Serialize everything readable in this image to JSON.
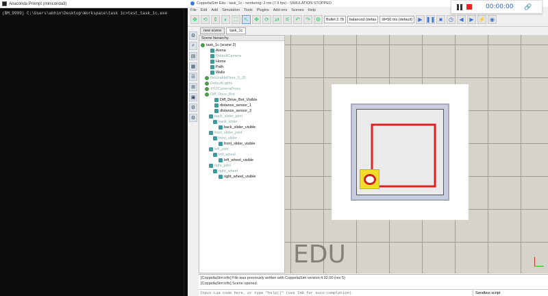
{
  "cmd": {
    "title": "Anaconda Prompt (miniconda3)",
    "line": "(BM_9999) C:\\Users\\abhin\\Desktop\\Workspace\\task 1c>test_task_1c.exe"
  },
  "coppelia": {
    "title": "CoppeliaSim Edu - task_1c - rendering: 2 ms (7.9 fps) - SIMULATION STOPPED",
    "menu": [
      "File",
      "Edit",
      "Add",
      "Simulation",
      "Tools",
      "Plugins",
      "Add-ons",
      "Scenes",
      "Help"
    ],
    "engine": "Bullet 2.78",
    "mode": "balanced (defau",
    "dt": "dt=50 ms (default)",
    "tabs": [
      "new scene",
      "task_1c"
    ],
    "hierarchy_title": "Scene hierarchy",
    "tree": [
      {
        "label": "task_1c (scene 2)",
        "x": 2,
        "dim": false,
        "icon": "globe"
      },
      {
        "label": "Arena",
        "x": 16,
        "dim": false,
        "icon": "shape"
      },
      {
        "label": "DefaultCamera",
        "x": 16,
        "dim": true,
        "icon": "shape"
      },
      {
        "label": "Home",
        "x": 16,
        "dim": false,
        "icon": "shape"
      },
      {
        "label": "Path",
        "x": 16,
        "dim": false,
        "icon": "shape"
      },
      {
        "label": "Walls",
        "x": 16,
        "dim": false,
        "icon": "shape"
      },
      {
        "label": "ResizableFloor_5_25",
        "x": 8,
        "dim": true,
        "icon": "globe"
      },
      {
        "label": "DefaultLights",
        "x": 8,
        "dim": true,
        "icon": "globe"
      },
      {
        "label": "XYZCameraProxy",
        "x": 8,
        "dim": true,
        "icon": "globe"
      },
      {
        "label": "Diff_Drive_Bot",
        "x": 8,
        "dim": true,
        "icon": "globe"
      },
      {
        "label": "Diff_Drive_Bot_Visible",
        "x": 22,
        "dim": false,
        "icon": "shape"
      },
      {
        "label": "distance_sensor_1",
        "x": 22,
        "dim": false,
        "icon": "shape"
      },
      {
        "label": "distance_sensor_2",
        "x": 22,
        "dim": false,
        "icon": "shape"
      },
      {
        "label": "back_slider_joint",
        "x": 14,
        "dim": true,
        "icon": "shape"
      },
      {
        "label": "back_slider",
        "x": 20,
        "dim": true,
        "icon": "shape"
      },
      {
        "label": "back_slider_visible",
        "x": 28,
        "dim": false,
        "icon": "shape"
      },
      {
        "label": "front_slider_joint",
        "x": 14,
        "dim": true,
        "icon": "shape"
      },
      {
        "label": "front_slider",
        "x": 20,
        "dim": true,
        "icon": "shape"
      },
      {
        "label": "front_slider_visible",
        "x": 28,
        "dim": false,
        "icon": "shape"
      },
      {
        "label": "left_joint",
        "x": 14,
        "dim": true,
        "icon": "shape"
      },
      {
        "label": "left_wheel",
        "x": 20,
        "dim": true,
        "icon": "shape"
      },
      {
        "label": "left_wheel_visible",
        "x": 28,
        "dim": false,
        "icon": "shape"
      },
      {
        "label": "right_joint",
        "x": 14,
        "dim": true,
        "icon": "shape"
      },
      {
        "label": "right_wheel",
        "x": 20,
        "dim": true,
        "icon": "shape"
      },
      {
        "label": "right_wheel_visible",
        "x": 28,
        "dim": false,
        "icon": "shape"
      }
    ],
    "watermark": "EDU",
    "status": [
      "[CoppeliaSim:info]  File was previously written with CoppeliaSim version 4.02.00 (rev 5)",
      "[CoppeliaSim:info]  Scene opened."
    ],
    "lua_placeholder": "Input Lua code here, or type \"help()\" (use TAB for auto-completion)",
    "sandbox": "Sandbox script"
  },
  "recorder": {
    "time": "00:00:00"
  }
}
